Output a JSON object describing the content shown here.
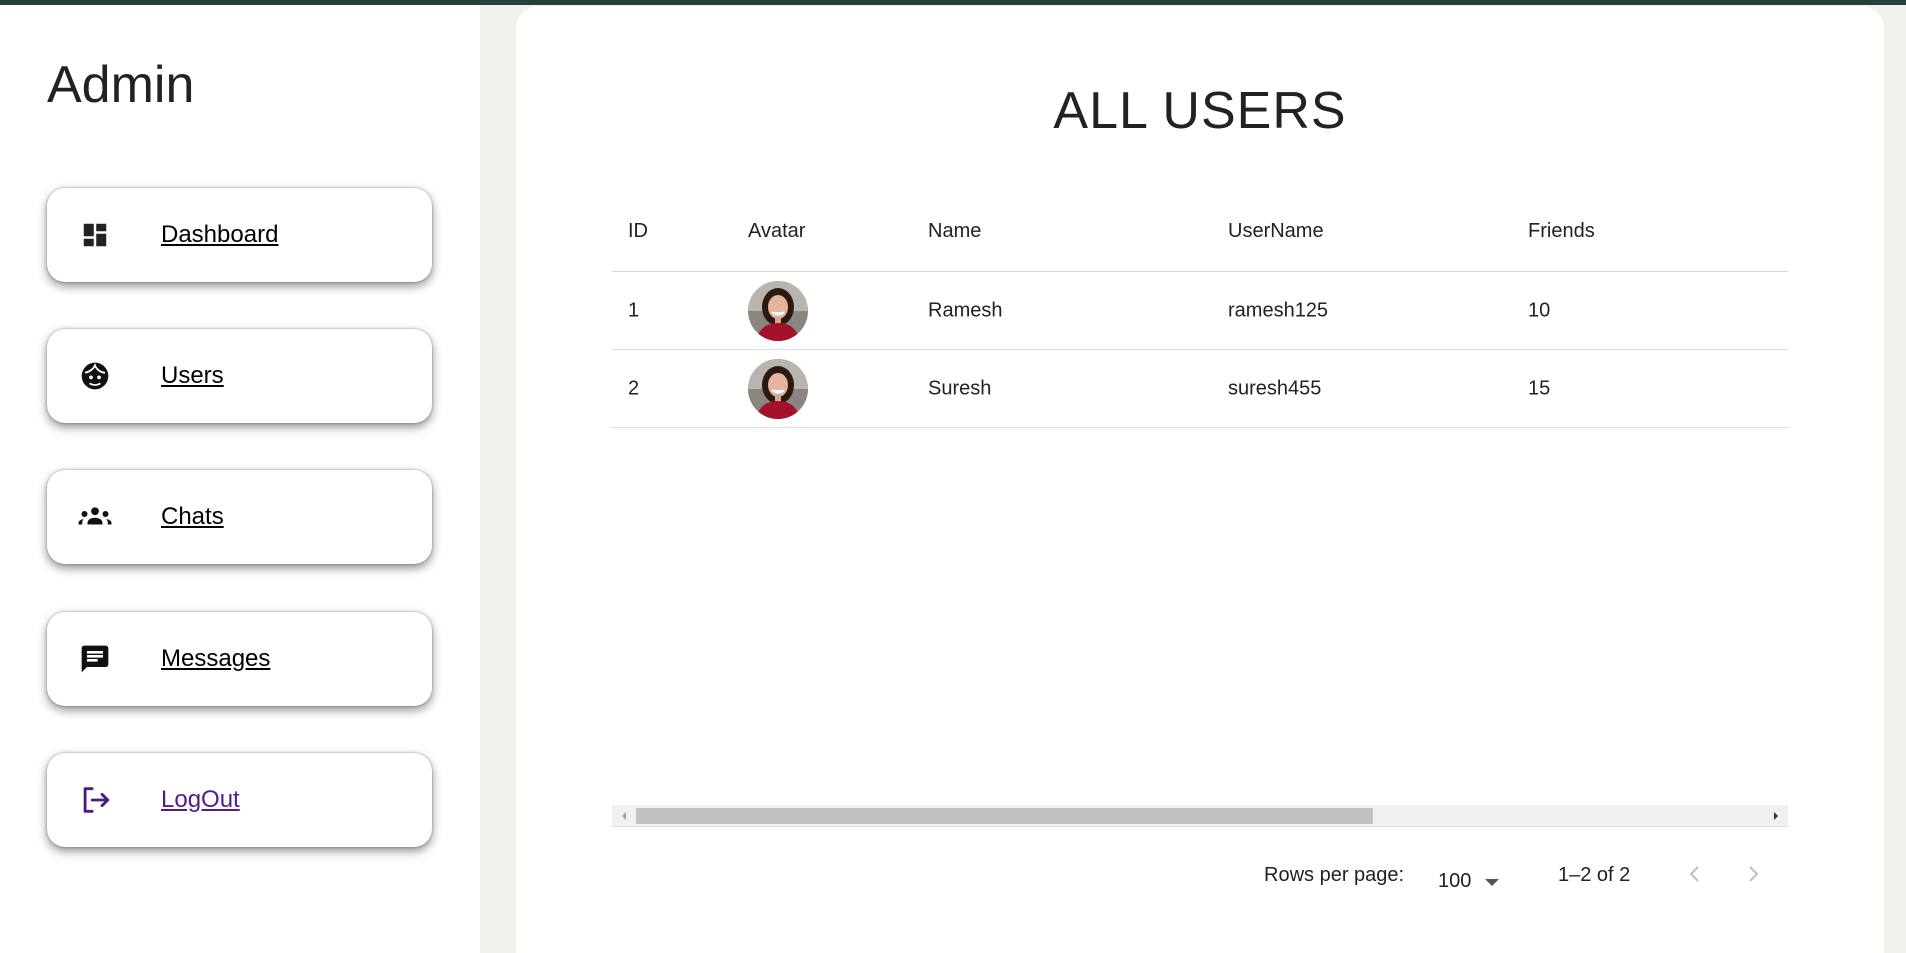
{
  "app": {
    "brand": "Admin"
  },
  "sidebar": {
    "items": [
      {
        "label": "Dashboard",
        "icon": "dashboard-icon"
      },
      {
        "label": "Users",
        "icon": "face-icon"
      },
      {
        "label": "Chats",
        "icon": "groups-icon"
      },
      {
        "label": "Messages",
        "icon": "message-icon"
      },
      {
        "label": "LogOut",
        "icon": "logout-icon"
      }
    ]
  },
  "main": {
    "title": "ALL USERS",
    "table": {
      "columns": [
        "ID",
        "Avatar",
        "Name",
        "UserName",
        "Friends"
      ],
      "rows": [
        {
          "id": "1",
          "avatar": "avatar-photo",
          "name": "Ramesh",
          "username": "ramesh125",
          "friends": "10"
        },
        {
          "id": "2",
          "avatar": "avatar-photo",
          "name": "Suresh",
          "username": "suresh455",
          "friends": "15"
        }
      ]
    },
    "pagination": {
      "rows_per_page_label": "Rows per page:",
      "rows_per_page_value": "100",
      "range": "1–2 of 2"
    }
  },
  "colors": {
    "topbar": "#25403a",
    "background": "#f1f1ec",
    "logout_accent": "#551a8b",
    "avatar_shirt": "#a3122a"
  }
}
